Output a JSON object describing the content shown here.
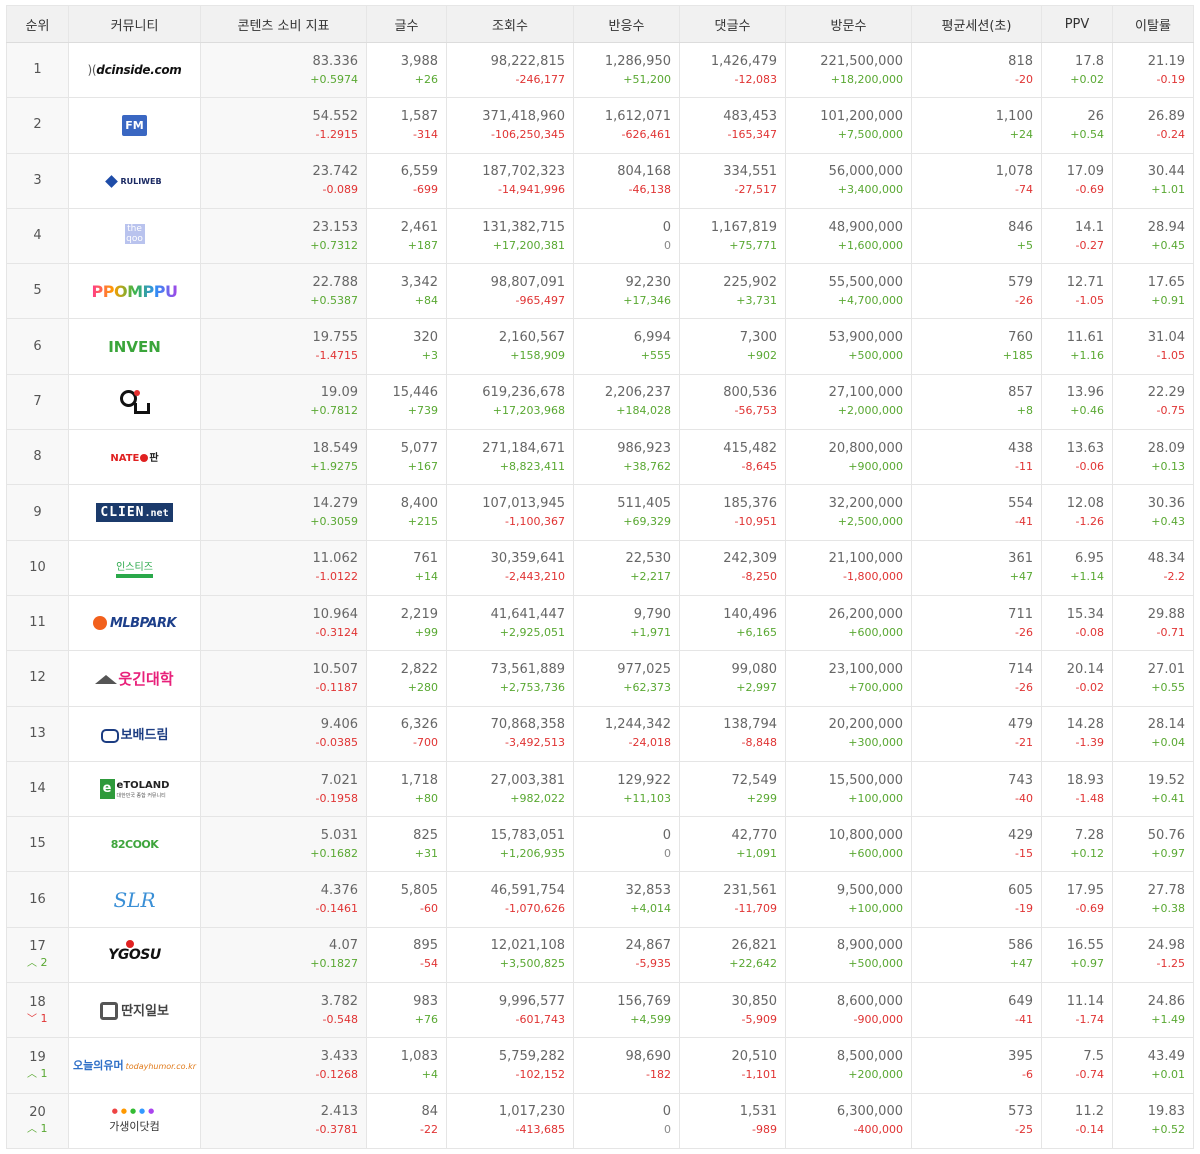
{
  "columns": [
    "순위",
    "커뮤니티",
    "콘텐츠 소비 지표",
    "글수",
    "조회수",
    "반응수",
    "댓글수",
    "방문수",
    "평균세션(초)",
    "PPV",
    "이탈률"
  ],
  "colors": {
    "positive": "#59a832",
    "negative": "#e03333",
    "header_bg": "#f1f1f1",
    "metric_bg": "#f8f8f8"
  },
  "rows": [
    {
      "rank": "1",
      "rank_change": null,
      "logo": {
        "icon": "dcinside-logo",
        "text": "dcinside.com"
      },
      "metric": "83.336",
      "metric_diff": "+0.5974",
      "posts": "3,988",
      "posts_diff": "+26",
      "views": "98,222,815",
      "views_diff": "-246,177",
      "reactions": "1,286,950",
      "reactions_diff": "+51,200",
      "comments": "1,426,479",
      "comments_diff": "-12,083",
      "visits": "221,500,000",
      "visits_diff": "+18,200,000",
      "session": "818",
      "session_diff": "-20",
      "ppv": "17.8",
      "ppv_diff": "+0.02",
      "bounce": "21.19",
      "bounce_diff": "-0.19"
    },
    {
      "rank": "2",
      "rank_change": null,
      "logo": {
        "icon": "fmkorea-logo",
        "text": "FM"
      },
      "metric": "54.552",
      "metric_diff": "-1.2915",
      "posts": "1,587",
      "posts_diff": "-314",
      "views": "371,418,960",
      "views_diff": "-106,250,345",
      "reactions": "1,612,071",
      "reactions_diff": "-626,461",
      "comments": "483,453",
      "comments_diff": "-165,347",
      "visits": "101,200,000",
      "visits_diff": "+7,500,000",
      "session": "1,100",
      "session_diff": "+24",
      "ppv": "26",
      "ppv_diff": "+0.54",
      "bounce": "26.89",
      "bounce_diff": "-0.24"
    },
    {
      "rank": "3",
      "rank_change": null,
      "logo": {
        "icon": "ruliweb-logo",
        "text": "RULIWEB"
      },
      "metric": "23.742",
      "metric_diff": "-0.089",
      "posts": "6,559",
      "posts_diff": "-699",
      "views": "187,702,323",
      "views_diff": "-14,941,996",
      "reactions": "804,168",
      "reactions_diff": "-46,138",
      "comments": "334,551",
      "comments_diff": "-27,517",
      "visits": "56,000,000",
      "visits_diff": "+3,400,000",
      "session": "1,078",
      "session_diff": "-74",
      "ppv": "17.09",
      "ppv_diff": "-0.69",
      "bounce": "30.44",
      "bounce_diff": "+1.01"
    },
    {
      "rank": "4",
      "rank_change": null,
      "logo": {
        "icon": "theqoo-logo",
        "text": "theqoo"
      },
      "metric": "23.153",
      "metric_diff": "+0.7312",
      "posts": "2,461",
      "posts_diff": "+187",
      "views": "131,382,715",
      "views_diff": "+17,200,381",
      "reactions": "0",
      "reactions_diff": "0",
      "comments": "1,167,819",
      "comments_diff": "+75,771",
      "visits": "48,900,000",
      "visits_diff": "+1,600,000",
      "session": "846",
      "session_diff": "+5",
      "ppv": "14.1",
      "ppv_diff": "-0.27",
      "bounce": "28.94",
      "bounce_diff": "+0.45"
    },
    {
      "rank": "5",
      "rank_change": null,
      "logo": {
        "icon": "ppomppu-logo",
        "text": "PPOMPPU"
      },
      "metric": "22.788",
      "metric_diff": "+0.5387",
      "posts": "3,342",
      "posts_diff": "+84",
      "views": "98,807,091",
      "views_diff": "-965,497",
      "reactions": "92,230",
      "reactions_diff": "+17,346",
      "comments": "225,902",
      "comments_diff": "+3,731",
      "visits": "55,500,000",
      "visits_diff": "+4,700,000",
      "session": "579",
      "session_diff": "-26",
      "ppv": "12.71",
      "ppv_diff": "-1.05",
      "bounce": "17.65",
      "bounce_diff": "+0.91"
    },
    {
      "rank": "6",
      "rank_change": null,
      "logo": {
        "icon": "inven-logo",
        "text": "INVEN"
      },
      "metric": "19.755",
      "metric_diff": "-1.4715",
      "posts": "320",
      "posts_diff": "+3",
      "views": "2,160,567",
      "views_diff": "+158,909",
      "reactions": "6,994",
      "reactions_diff": "+555",
      "comments": "7,300",
      "comments_diff": "+902",
      "visits": "53,900,000",
      "visits_diff": "+500,000",
      "session": "760",
      "session_diff": "+185",
      "ppv": "11.61",
      "ppv_diff": "+1.16",
      "bounce": "31.04",
      "bounce_diff": "-1.05"
    },
    {
      "rank": "7",
      "rank_change": null,
      "logo": {
        "icon": "ou-logo",
        "text": ""
      },
      "metric": "19.09",
      "metric_diff": "+0.7812",
      "posts": "15,446",
      "posts_diff": "+739",
      "views": "619,236,678",
      "views_diff": "+17,203,968",
      "reactions": "2,206,237",
      "reactions_diff": "+184,028",
      "comments": "800,536",
      "comments_diff": "-56,753",
      "visits": "27,100,000",
      "visits_diff": "+2,000,000",
      "session": "857",
      "session_diff": "+8",
      "ppv": "13.96",
      "ppv_diff": "+0.46",
      "bounce": "22.29",
      "bounce_diff": "-0.75"
    },
    {
      "rank": "8",
      "rank_change": null,
      "logo": {
        "icon": "natepann-logo",
        "text": "NATE",
        "text2": "판"
      },
      "metric": "18.549",
      "metric_diff": "+1.9275",
      "posts": "5,077",
      "posts_diff": "+167",
      "views": "271,184,671",
      "views_diff": "+8,823,411",
      "reactions": "986,923",
      "reactions_diff": "+38,762",
      "comments": "415,482",
      "comments_diff": "-8,645",
      "visits": "20,800,000",
      "visits_diff": "+900,000",
      "session": "438",
      "session_diff": "-11",
      "ppv": "13.63",
      "ppv_diff": "-0.06",
      "bounce": "28.09",
      "bounce_diff": "+0.13"
    },
    {
      "rank": "9",
      "rank_change": null,
      "logo": {
        "icon": "clien-logo",
        "text": "CLIEN",
        "text2": ".net"
      },
      "metric": "14.279",
      "metric_diff": "+0.3059",
      "posts": "8,400",
      "posts_diff": "+215",
      "views": "107,013,945",
      "views_diff": "-1,100,367",
      "reactions": "511,405",
      "reactions_diff": "+69,329",
      "comments": "185,376",
      "comments_diff": "-10,951",
      "visits": "32,200,000",
      "visits_diff": "+2,500,000",
      "session": "554",
      "session_diff": "-41",
      "ppv": "12.08",
      "ppv_diff": "-1.26",
      "bounce": "30.36",
      "bounce_diff": "+0.43"
    },
    {
      "rank": "10",
      "rank_change": null,
      "logo": {
        "icon": "instiz-logo",
        "text": "인스티즈"
      },
      "metric": "11.062",
      "metric_diff": "-1.0122",
      "posts": "761",
      "posts_diff": "+14",
      "views": "30,359,641",
      "views_diff": "-2,443,210",
      "reactions": "22,530",
      "reactions_diff": "+2,217",
      "comments": "242,309",
      "comments_diff": "-8,250",
      "visits": "21,100,000",
      "visits_diff": "-1,800,000",
      "session": "361",
      "session_diff": "+47",
      "ppv": "6.95",
      "ppv_diff": "+1.14",
      "bounce": "48.34",
      "bounce_diff": "-2.2"
    },
    {
      "rank": "11",
      "rank_change": null,
      "logo": {
        "icon": "mlbpark-logo",
        "text": "MLBPARK"
      },
      "metric": "10.964",
      "metric_diff": "-0.3124",
      "posts": "2,219",
      "posts_diff": "+99",
      "views": "41,641,447",
      "views_diff": "+2,925,051",
      "reactions": "9,790",
      "reactions_diff": "+1,971",
      "comments": "140,496",
      "comments_diff": "+6,165",
      "visits": "26,200,000",
      "visits_diff": "+600,000",
      "session": "711",
      "session_diff": "-26",
      "ppv": "15.34",
      "ppv_diff": "-0.08",
      "bounce": "29.88",
      "bounce_diff": "-0.71"
    },
    {
      "rank": "12",
      "rank_change": null,
      "logo": {
        "icon": "humoruniv-logo",
        "text": "웃긴대학"
      },
      "metric": "10.507",
      "metric_diff": "-0.1187",
      "posts": "2,822",
      "posts_diff": "+280",
      "views": "73,561,889",
      "views_diff": "+2,753,736",
      "reactions": "977,025",
      "reactions_diff": "+62,373",
      "comments": "99,080",
      "comments_diff": "+2,997",
      "visits": "23,100,000",
      "visits_diff": "+700,000",
      "session": "714",
      "session_diff": "-26",
      "ppv": "20.14",
      "ppv_diff": "-0.02",
      "bounce": "27.01",
      "bounce_diff": "+0.55"
    },
    {
      "rank": "13",
      "rank_change": null,
      "logo": {
        "icon": "bobaedream-logo",
        "text": "보배드림"
      },
      "metric": "9.406",
      "metric_diff": "-0.0385",
      "posts": "6,326",
      "posts_diff": "-700",
      "views": "70,868,358",
      "views_diff": "-3,492,513",
      "reactions": "1,244,342",
      "reactions_diff": "-24,018",
      "comments": "138,794",
      "comments_diff": "-8,848",
      "visits": "20,200,000",
      "visits_diff": "+300,000",
      "session": "479",
      "session_diff": "-21",
      "ppv": "14.28",
      "ppv_diff": "-1.39",
      "bounce": "28.14",
      "bounce_diff": "+0.04"
    },
    {
      "rank": "14",
      "rank_change": null,
      "logo": {
        "icon": "etoland-logo",
        "text": "eTOLAND",
        "text2": "대한민국 종합 커뮤니티"
      },
      "metric": "7.021",
      "metric_diff": "-0.1958",
      "posts": "1,718",
      "posts_diff": "+80",
      "views": "27,003,381",
      "views_diff": "+982,022",
      "reactions": "129,922",
      "reactions_diff": "+11,103",
      "comments": "72,549",
      "comments_diff": "+299",
      "visits": "15,500,000",
      "visits_diff": "+100,000",
      "session": "743",
      "session_diff": "-40",
      "ppv": "18.93",
      "ppv_diff": "-1.48",
      "bounce": "19.52",
      "bounce_diff": "+0.41"
    },
    {
      "rank": "15",
      "rank_change": null,
      "logo": {
        "icon": "82cook-logo",
        "text": "82COOK"
      },
      "metric": "5.031",
      "metric_diff": "+0.1682",
      "posts": "825",
      "posts_diff": "+31",
      "views": "15,783,051",
      "views_diff": "+1,206,935",
      "reactions": "0",
      "reactions_diff": "0",
      "comments": "42,770",
      "comments_diff": "+1,091",
      "visits": "10,800,000",
      "visits_diff": "+600,000",
      "session": "429",
      "session_diff": "-15",
      "ppv": "7.28",
      "ppv_diff": "+0.12",
      "bounce": "50.76",
      "bounce_diff": "+0.97"
    },
    {
      "rank": "16",
      "rank_change": null,
      "logo": {
        "icon": "slr-logo",
        "text": "SLR"
      },
      "metric": "4.376",
      "metric_diff": "-0.1461",
      "posts": "5,805",
      "posts_diff": "-60",
      "views": "46,591,754",
      "views_diff": "-1,070,626",
      "reactions": "32,853",
      "reactions_diff": "+4,014",
      "comments": "231,561",
      "comments_diff": "-11,709",
      "visits": "9,500,000",
      "visits_diff": "+100,000",
      "session": "605",
      "session_diff": "-19",
      "ppv": "17.95",
      "ppv_diff": "-0.69",
      "bounce": "27.78",
      "bounce_diff": "+0.38"
    },
    {
      "rank": "17",
      "rank_change": {
        "dir": "up",
        "value": "2"
      },
      "logo": {
        "icon": "ygosu-logo",
        "text": "YGOSU"
      },
      "metric": "4.07",
      "metric_diff": "+0.1827",
      "posts": "895",
      "posts_diff": "-54",
      "views": "12,021,108",
      "views_diff": "+3,500,825",
      "reactions": "24,867",
      "reactions_diff": "-5,935",
      "comments": "26,821",
      "comments_diff": "+22,642",
      "visits": "8,900,000",
      "visits_diff": "+500,000",
      "session": "586",
      "session_diff": "+47",
      "ppv": "16.55",
      "ppv_diff": "+0.97",
      "bounce": "24.98",
      "bounce_diff": "-1.25"
    },
    {
      "rank": "18",
      "rank_change": {
        "dir": "down",
        "value": "1"
      },
      "logo": {
        "icon": "ddanzi-logo",
        "text": "딴지일보"
      },
      "metric": "3.782",
      "metric_diff": "-0.548",
      "posts": "983",
      "posts_diff": "+76",
      "views": "9,996,577",
      "views_diff": "-601,743",
      "reactions": "156,769",
      "reactions_diff": "+4,599",
      "comments": "30,850",
      "comments_diff": "-5,909",
      "visits": "8,600,000",
      "visits_diff": "-900,000",
      "session": "649",
      "session_diff": "-41",
      "ppv": "11.14",
      "ppv_diff": "-1.74",
      "bounce": "24.86",
      "bounce_diff": "+1.49"
    },
    {
      "rank": "19",
      "rank_change": {
        "dir": "up",
        "value": "1"
      },
      "logo": {
        "icon": "todayhumor-logo",
        "text": "오늘의유머",
        "text2": "todayhumor.co.kr"
      },
      "metric": "3.433",
      "metric_diff": "-0.1268",
      "posts": "1,083",
      "posts_diff": "+4",
      "views": "5,759,282",
      "views_diff": "-102,152",
      "reactions": "98,690",
      "reactions_diff": "-182",
      "comments": "20,510",
      "comments_diff": "-1,101",
      "visits": "8,500,000",
      "visits_diff": "+200,000",
      "session": "395",
      "session_diff": "-6",
      "ppv": "7.5",
      "ppv_diff": "-0.74",
      "bounce": "43.49",
      "bounce_diff": "+0.01"
    },
    {
      "rank": "20",
      "rank_change": {
        "dir": "up",
        "value": "1"
      },
      "logo": {
        "icon": "gasengi-logo",
        "text": "가생이닷컴"
      },
      "metric": "2.413",
      "metric_diff": "-0.3781",
      "posts": "84",
      "posts_diff": "-22",
      "views": "1,017,230",
      "views_diff": "-413,685",
      "reactions": "0",
      "reactions_diff": "0",
      "comments": "1,531",
      "comments_diff": "-989",
      "visits": "6,300,000",
      "visits_diff": "-400,000",
      "session": "573",
      "session_diff": "-25",
      "ppv": "11.2",
      "ppv_diff": "-0.14",
      "bounce": "19.83",
      "bounce_diff": "+0.52"
    }
  ]
}
